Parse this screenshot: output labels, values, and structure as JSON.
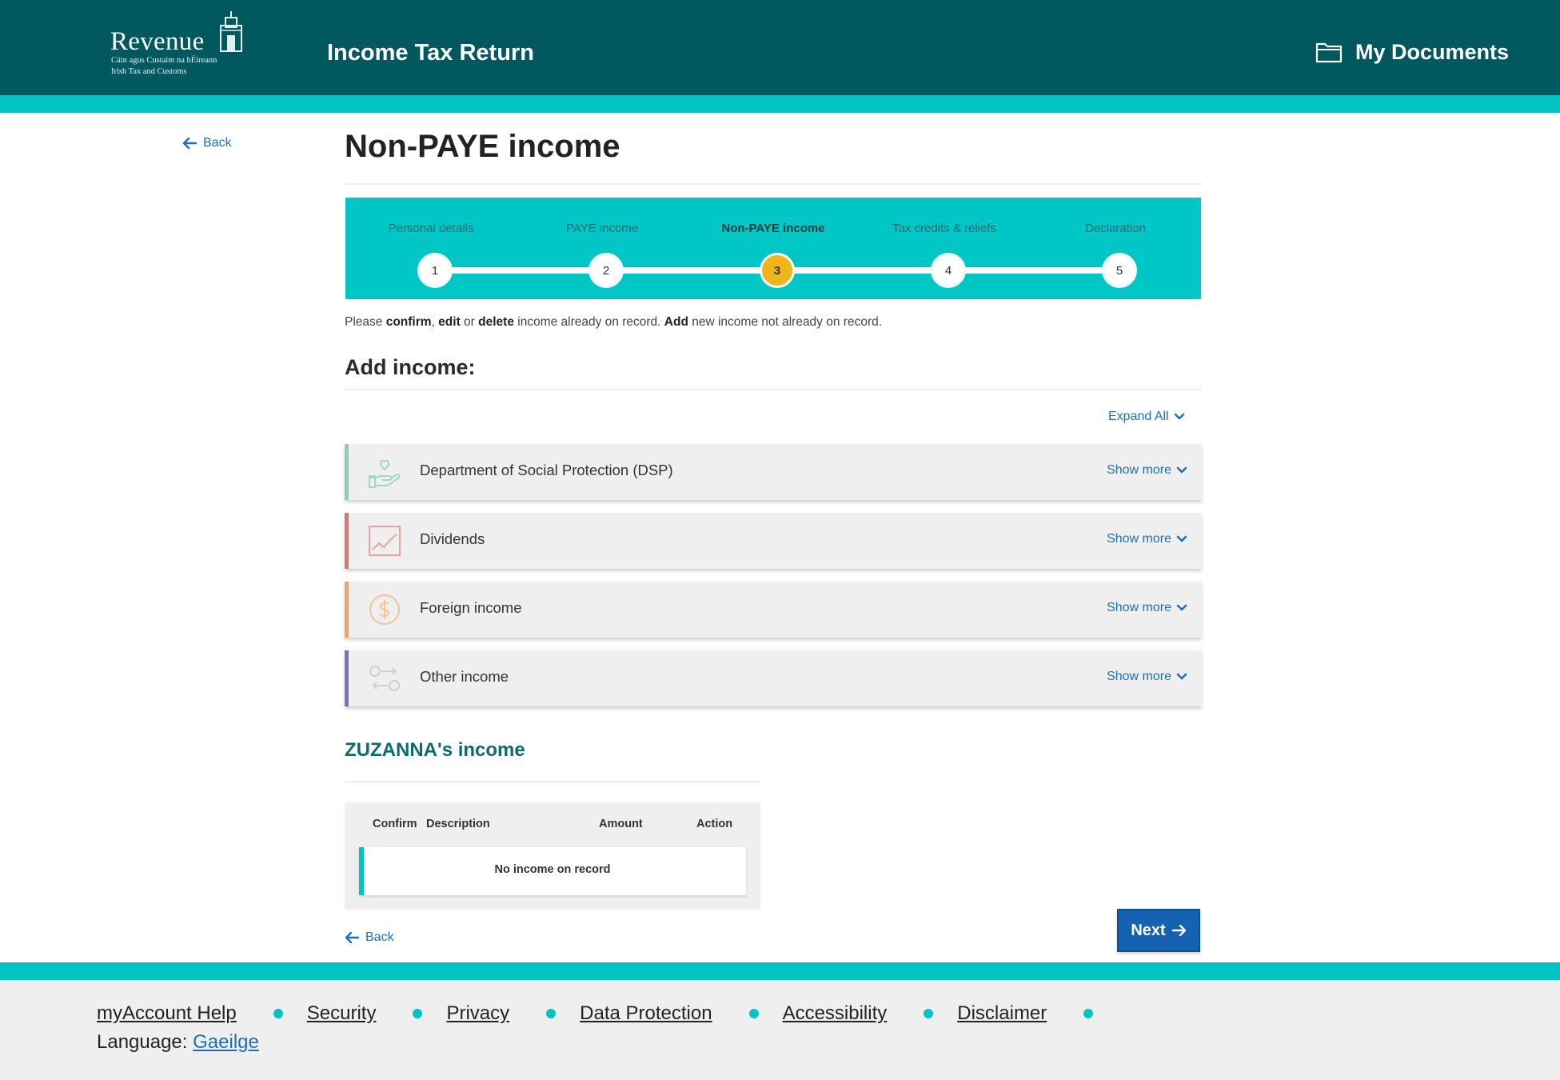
{
  "header": {
    "logo_word": "Revenue",
    "logo_line1": "Cáin agus Custaim na hÉireann",
    "logo_line2": "Irish Tax and Customs",
    "app_title": "Income Tax Return",
    "my_documents": "My Documents"
  },
  "nav": {
    "back_top": "Back",
    "back_bottom": "Back"
  },
  "page": {
    "title": "Non-PAYE income",
    "instructions": {
      "t1": "Please ",
      "confirm": "confirm",
      "t2": ", ",
      "edit": "edit",
      "t3": " or ",
      "delete": "delete",
      "t4": " income already on record. ",
      "add": "Add",
      "t5": " new income not already on record."
    },
    "add_income_title": "Add income:",
    "expand_all": "Expand All"
  },
  "stepper": {
    "current_step": 3,
    "steps": [
      {
        "label": "Personal details",
        "number": "1"
      },
      {
        "label": "PAYE income",
        "number": "2"
      },
      {
        "label": "Non-PAYE income",
        "number": "3"
      },
      {
        "label": "Tax credits & reliefs",
        "number": "4"
      },
      {
        "label": "Declaration",
        "number": "5"
      }
    ]
  },
  "income_categories": [
    {
      "label": "Department of Social Protection (DSP)",
      "show_more": "Show more",
      "accent_color": "#8ccfb8",
      "icon": "hand-heart-icon"
    },
    {
      "label": "Dividends",
      "show_more": "Show more",
      "accent_color": "#e0736b",
      "icon": "chart-line-icon"
    },
    {
      "label": "Foreign income",
      "show_more": "Show more",
      "accent_color": "#f2a462",
      "icon": "dollar-coin-icon"
    },
    {
      "label": "Other income",
      "show_more": "Show more",
      "accent_color": "#7a6fc0",
      "icon": "exchange-icon"
    }
  ],
  "person_income": {
    "title": "ZUZANNA's income",
    "columns": [
      "Confirm",
      "Description",
      "Amount",
      "Action"
    ],
    "empty_message": "No income on record"
  },
  "actions": {
    "next": "Next"
  },
  "footer": {
    "links": [
      "myAccount Help",
      "Security",
      "Privacy",
      "Data Protection",
      "Accessibility",
      "Disclaimer"
    ],
    "language_label": "Language:",
    "language_link": "Gaeilge"
  },
  "colors": {
    "header_bg": "#02585f",
    "accent_teal": "#00c3c3",
    "active_step": "#f0b51a",
    "primary_button": "#1563b0",
    "link_blue": "#1d6fb8"
  }
}
